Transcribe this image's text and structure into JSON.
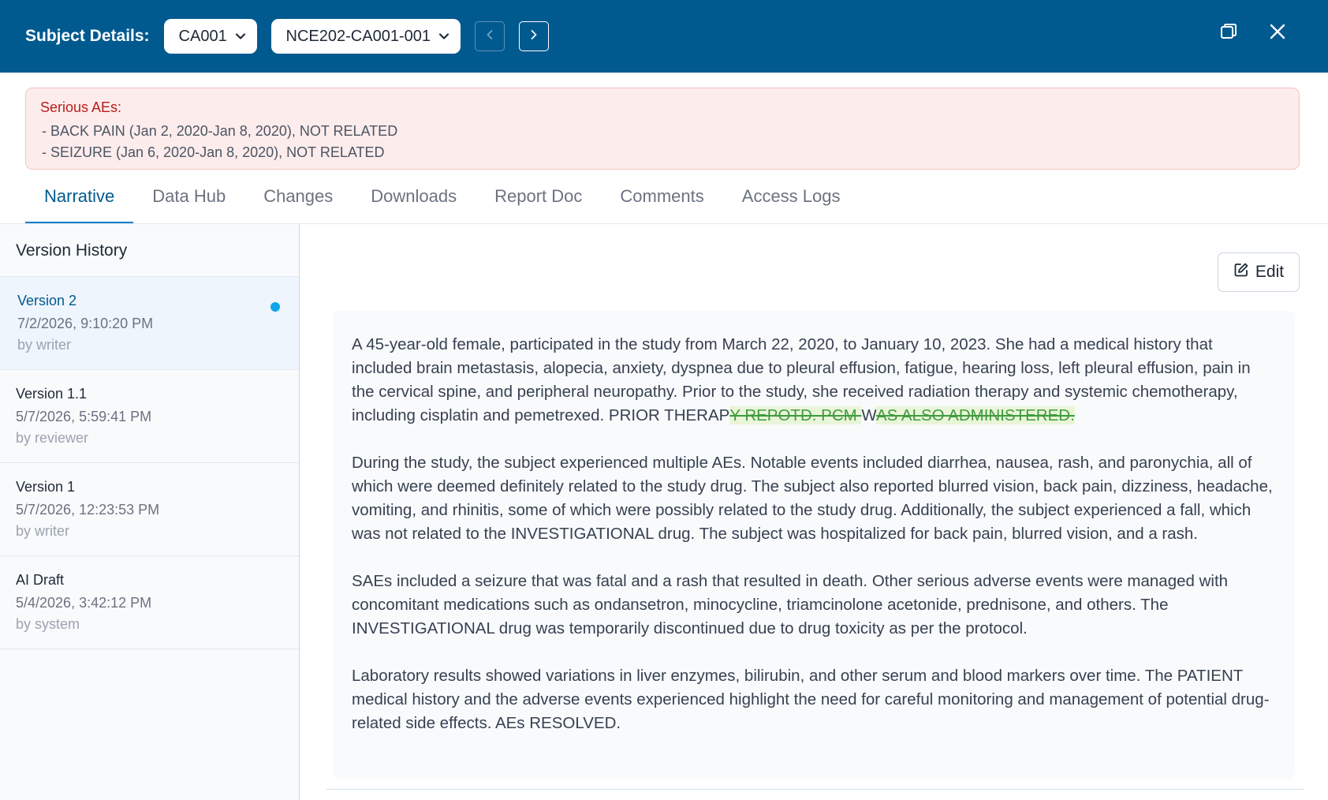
{
  "header": {
    "title": "Subject Details:",
    "site_select": "CA001",
    "subject_select": "NCE202-CA001-001"
  },
  "alert": {
    "title": "Serious AEs:",
    "items": [
      "- BACK PAIN (Jan 2, 2020-Jan 8, 2020), NOT RELATED",
      "- SEIZURE (Jan 6, 2020-Jan 8, 2020), NOT RELATED"
    ]
  },
  "tabs": [
    {
      "label": "Narrative"
    },
    {
      "label": "Data Hub"
    },
    {
      "label": "Changes"
    },
    {
      "label": "Downloads"
    },
    {
      "label": "Report Doc"
    },
    {
      "label": "Comments"
    },
    {
      "label": "Access Logs"
    }
  ],
  "sidebar": {
    "title": "Version History",
    "versions": [
      {
        "name": "Version 2",
        "date": "7/2/2026, 9:10:20 PM",
        "author": "by writer"
      },
      {
        "name": "Version 1.1",
        "date": "5/7/2026, 5:59:41 PM",
        "author": "by reviewer"
      },
      {
        "name": "Version 1",
        "date": "5/7/2026, 12:23:53 PM",
        "author": "by writer"
      },
      {
        "name": "AI Draft",
        "date": "5/4/2026, 3:42:12 PM",
        "author": "by system"
      }
    ]
  },
  "main": {
    "edit_label": "Edit",
    "paragraph1_text": "A 45-year-old female, participated in the study from March 22, 2020, to January 10, 2023. She had a medical history that included brain metastasis, alopecia, anxiety, dyspnea due to pleural effusion, fatigue, hearing loss, left pleural effusion, pain in the cervical spine, and peripheral neuropathy. Prior to the study, she received radiation therapy and systemic chemotherapy, including cisplatin and pemetrexed. PRIOR THERAP",
    "paragraph1_del1": "Y REPOTD. PCM ",
    "paragraph1_mid": "W",
    "paragraph1_del2": "AS ALSO ADMINISTERED.",
    "paragraph2": "During the study, the subject experienced multiple AEs. Notable events included diarrhea, nausea, rash, and paronychia, all of which were deemed definitely related to the study drug. The subject also reported blurred vision, back pain, dizziness, headache, vomiting, and rhinitis, some of which were possibly related to the study drug. Additionally, the subject experienced a fall, which was not related to the INVESTIGATIONAL drug. The subject was hospitalized for back pain, blurred vision, and a rash.",
    "paragraph3": "SAEs included a seizure that was fatal and a rash that resulted in death. Other serious adverse events were managed with concomitant medications such as ondansetron, minocycline, triamcinolone acetonide, prednisone, and others. The INVESTIGATIONAL drug was temporarily discontinued due to drug toxicity as per the protocol.",
    "paragraph4": "Laboratory results showed variations in liver enzymes, bilirubin, and other serum and blood markers over time. The PATIENT medical history and the adverse events experienced highlight the need for careful monitoring and management of potential drug-related side effects. AEs RESOLVED."
  },
  "icons": {
    "dropdown": "chevron-down-icon",
    "prev": "chevron-left-icon",
    "next": "chevron-right-icon",
    "restore": "restore-window-icon",
    "close": "close-icon",
    "edit": "edit-icon"
  },
  "colors": {
    "header_bg": "#005a8f",
    "accent": "#0b7fc7",
    "alert_bg": "#fdecec",
    "alert_title": "#b91c1c",
    "deleted_text": "#3f9b3f",
    "deleted_bg": "#e9f5d8"
  }
}
